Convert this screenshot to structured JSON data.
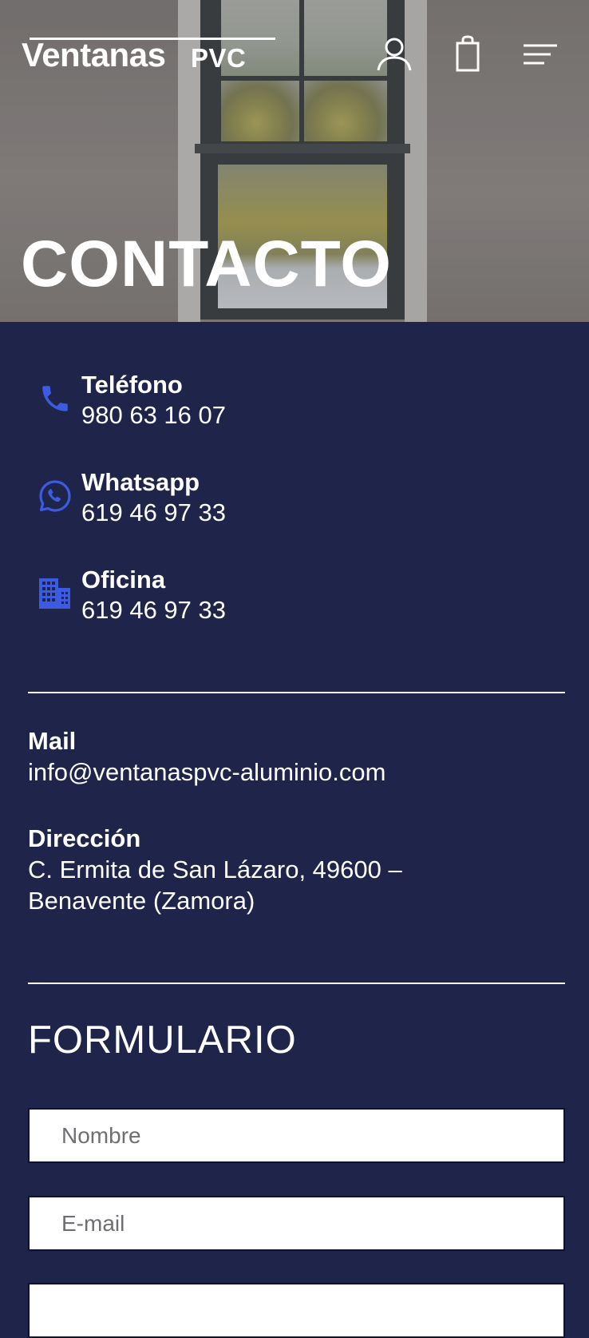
{
  "header": {
    "logo_main": "Ventanas",
    "logo_sub": "PVC",
    "icons": [
      "user-icon",
      "shopping-bag-icon",
      "menu-icon"
    ]
  },
  "hero": {
    "title": "CONTACTO"
  },
  "contact": {
    "items": [
      {
        "icon": "phone-icon",
        "label": "Teléfono",
        "value": "980 63 16 07"
      },
      {
        "icon": "whatsapp-icon",
        "label": "Whatsapp",
        "value": "619 46 97 33"
      },
      {
        "icon": "office-building-icon",
        "label": "Oficina",
        "value": "619 46 97 33"
      }
    ]
  },
  "info": {
    "mail_label": "Mail",
    "mail_value": "info@ventanaspvc-aluminio.com",
    "address_label": "Dirección",
    "address_line1": "C. Ermita de San Lázaro, 49600 –",
    "address_line2": "Benavente (Zamora)"
  },
  "form": {
    "title": "FORMULARIO",
    "name_placeholder": "Nombre",
    "email_placeholder": "E-mail"
  },
  "colors": {
    "background": "#1f244b",
    "accent": "#3d5be0",
    "text": "#ffffff"
  }
}
